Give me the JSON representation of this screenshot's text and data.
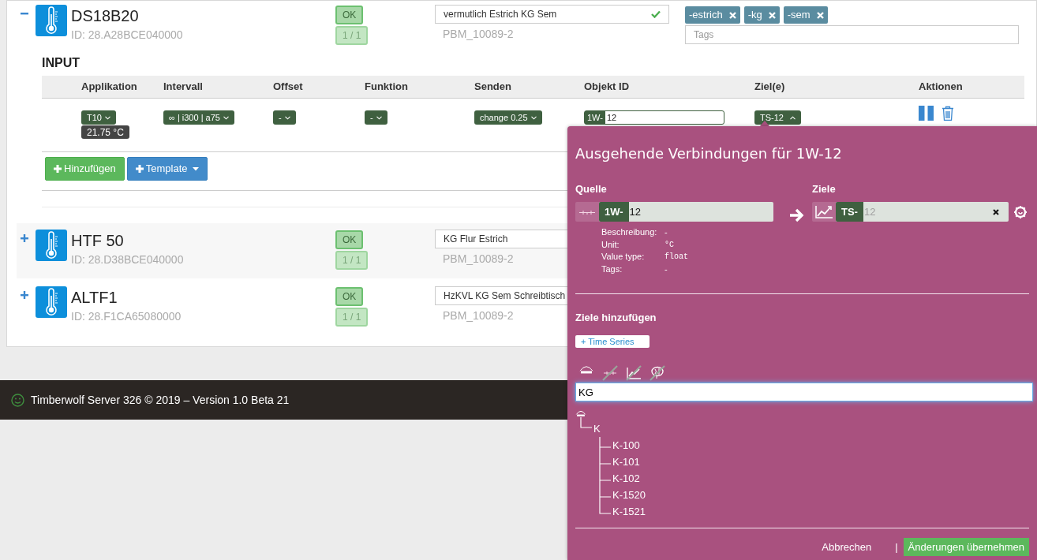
{
  "devices": [
    {
      "expanded": true,
      "name": "DS18B20",
      "id": "ID: 28.A28BCE040000",
      "status": "OK",
      "count": "1 / 1",
      "description": "vermutlich Estrich KG Sem",
      "description_valid": true,
      "location": "PBM_10089-2",
      "tags": [
        "-estrich",
        "-kg",
        "-sem"
      ],
      "tags_placeholder": "Tags"
    },
    {
      "expanded": false,
      "name": "HTF 50",
      "id": "ID: 28.D38BCE040000",
      "status": "OK",
      "count": "1 / 1",
      "description": "KG Flur Estrich",
      "location": "PBM_10089-2"
    },
    {
      "expanded": false,
      "name": "ALTF1",
      "id": "ID: 28.F1CA65080000",
      "status": "OK",
      "count": "1 / 1",
      "description": "HzKVL KG Sem Schreibtisch",
      "location": "PBM_10089-2"
    }
  ],
  "input_section": {
    "title": "INPUT",
    "columns": [
      "Applikation",
      "Intervall",
      "Offset",
      "Funktion",
      "Senden",
      "Objekt ID",
      "Ziel(e)",
      "Aktionen"
    ],
    "rows": [
      {
        "application": "T10",
        "reading": "21.75 °C",
        "interval": "∞ | i300 | a75",
        "offset": "-",
        "function": "-",
        "send": "change 0.25",
        "object_prefix": "1W-",
        "object_value": "12",
        "target": "TS-12",
        "target_expanded": true
      }
    ],
    "buttons": [
      {
        "kind": "add",
        "label": "Hinzufügen"
      },
      {
        "kind": "template",
        "label": "Template"
      }
    ]
  },
  "footer": "Timberwolf Server 326 © 2019 – Version 1.0 Beta 21",
  "popup": {
    "title": "Ausgehende Verbindungen für 1W-12",
    "source_label": "Quelle",
    "targets_label": "Ziele",
    "source": {
      "prefix": "1W-",
      "value": "12"
    },
    "details": [
      {
        "label": "Beschreibung:",
        "value": "-",
        "mono": false
      },
      {
        "label": "Unit:",
        "value": "°C",
        "mono": true
      },
      {
        "label": "Value type:",
        "value": "float",
        "mono": true
      },
      {
        "label": "Tags:",
        "value": "-",
        "mono": false
      }
    ],
    "target": {
      "prefix": "TS-",
      "placeholder": "12"
    },
    "add_title": "Ziele hinzufügen",
    "add_buttons": [
      "+ Time Series"
    ],
    "filters": [
      {
        "kind": "knx",
        "enabled": true
      },
      {
        "kind": "onewire",
        "enabled": false
      },
      {
        "kind": "timeseries",
        "enabled": false
      },
      {
        "kind": "logic",
        "enabled": false
      }
    ],
    "search": "KG",
    "tree": {
      "kind": "knx",
      "children": [
        {
          "label": "K",
          "children": [
            {
              "label": "K-100"
            },
            {
              "label": "K-101"
            },
            {
              "label": "K-102"
            },
            {
              "label": "K-1520"
            },
            {
              "label": "K-1521"
            }
          ]
        }
      ]
    },
    "cancel": "Abbrechen",
    "separator": "|",
    "apply": "Änderungen übernehmen"
  }
}
